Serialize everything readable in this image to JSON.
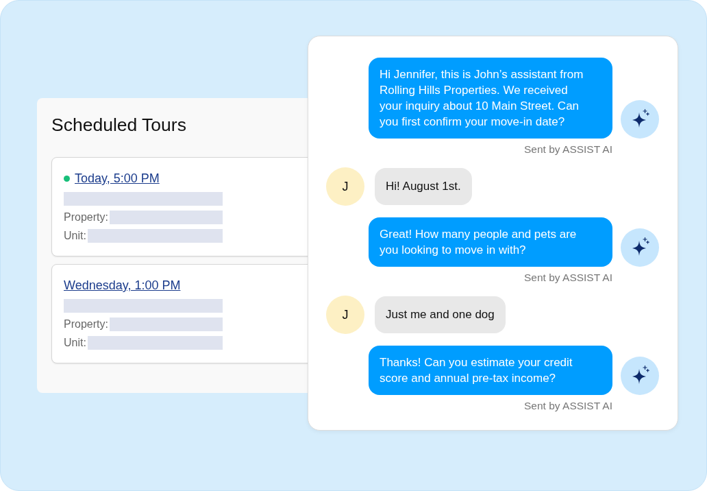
{
  "scheduled_tours": {
    "title": "Scheduled Tours",
    "tours": [
      {
        "time": "Today, 5:00 PM",
        "status_dot": true,
        "fields": [
          "Property:",
          "Unit:"
        ]
      },
      {
        "time": "Wednesday, 1:00 PM",
        "status_dot": false,
        "fields": [
          "Property:",
          "Unit:"
        ]
      }
    ]
  },
  "chat": {
    "messages": [
      {
        "kind": "assistant",
        "text": "Hi Jennifer, this is John’s assistant from Rolling Hills Properties. We received your inquiry about 10 Main Street. Can you first confirm your move-in date?",
        "footer": "Sent by ASSIST AI"
      },
      {
        "kind": "user",
        "avatar": "J",
        "text": "Hi! August 1st."
      },
      {
        "kind": "assistant",
        "text": "Great! How many people and pets are you looking to move in with?",
        "footer": "Sent by ASSIST AI"
      },
      {
        "kind": "user",
        "avatar": "J",
        "text": "Just me and one dog"
      },
      {
        "kind": "assistant",
        "text": "Thanks! Can you estimate your credit score and annual pre-tax income?",
        "footer": "Sent by ASSIST AI"
      }
    ]
  }
}
